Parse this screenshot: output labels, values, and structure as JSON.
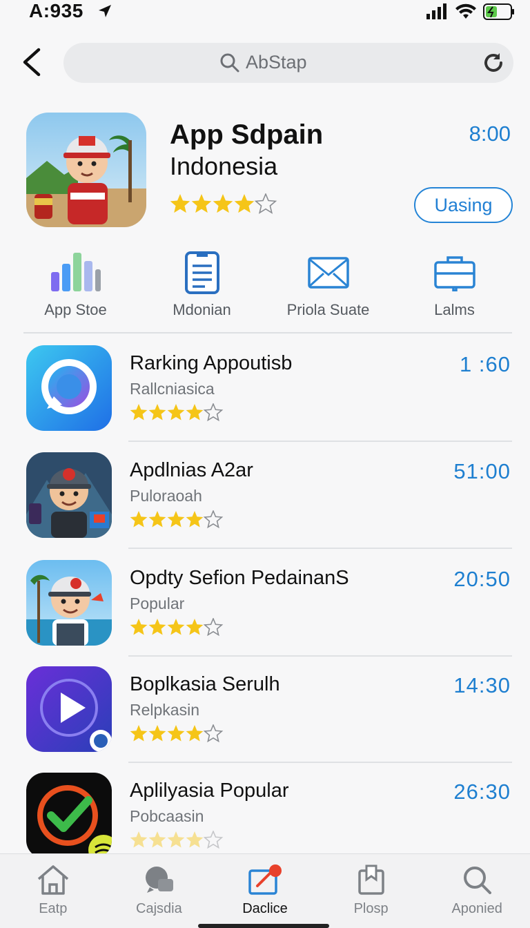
{
  "status_bar": {
    "time": "A:935"
  },
  "search": {
    "placeholder": "AbStap"
  },
  "hero": {
    "title_line1": "App Sdpain",
    "title_line2": "Indonesia",
    "time": "8:00",
    "rating": 4,
    "button_label": "Uasing"
  },
  "categories": [
    {
      "label": "App Stoe",
      "icon": "bar-chart-icon"
    },
    {
      "label": "Mdonian",
      "icon": "document-icon"
    },
    {
      "label": "Priola Suate",
      "icon": "mail-icon"
    },
    {
      "label": "Lalms",
      "icon": "briefcase-icon"
    }
  ],
  "apps": [
    {
      "name": "Rarking Appoutisb",
      "sub": "Rallcniasica",
      "duration": "1 :60",
      "rating": 4
    },
    {
      "name": "Apdlnias A2ar",
      "sub": "Puloraoah",
      "duration": "51:00",
      "rating": 4
    },
    {
      "name": "Opdty Sefion PedainanS",
      "sub": "Popular",
      "duration": "20:50",
      "rating": 4
    },
    {
      "name": "Boplkasia Serulh",
      "sub": "Relpkasin",
      "duration": "14:30",
      "rating": 4
    },
    {
      "name": "Aplilyasia Popular",
      "sub": "Pobcaasin",
      "duration": "26:30",
      "rating": 4
    }
  ],
  "tabs": [
    {
      "label": "Eatp",
      "icon": "home-icon"
    },
    {
      "label": "Cajsdia",
      "icon": "chat-icon"
    },
    {
      "label": "Daclice",
      "icon": "edit-icon",
      "active": true
    },
    {
      "label": "Plosp",
      "icon": "clipboard-icon"
    },
    {
      "label": "Aponied",
      "icon": "search-icon"
    }
  ],
  "colors": {
    "accent": "#1e7fd0",
    "star": "#f5c518",
    "badge_red": "#e8412b"
  }
}
